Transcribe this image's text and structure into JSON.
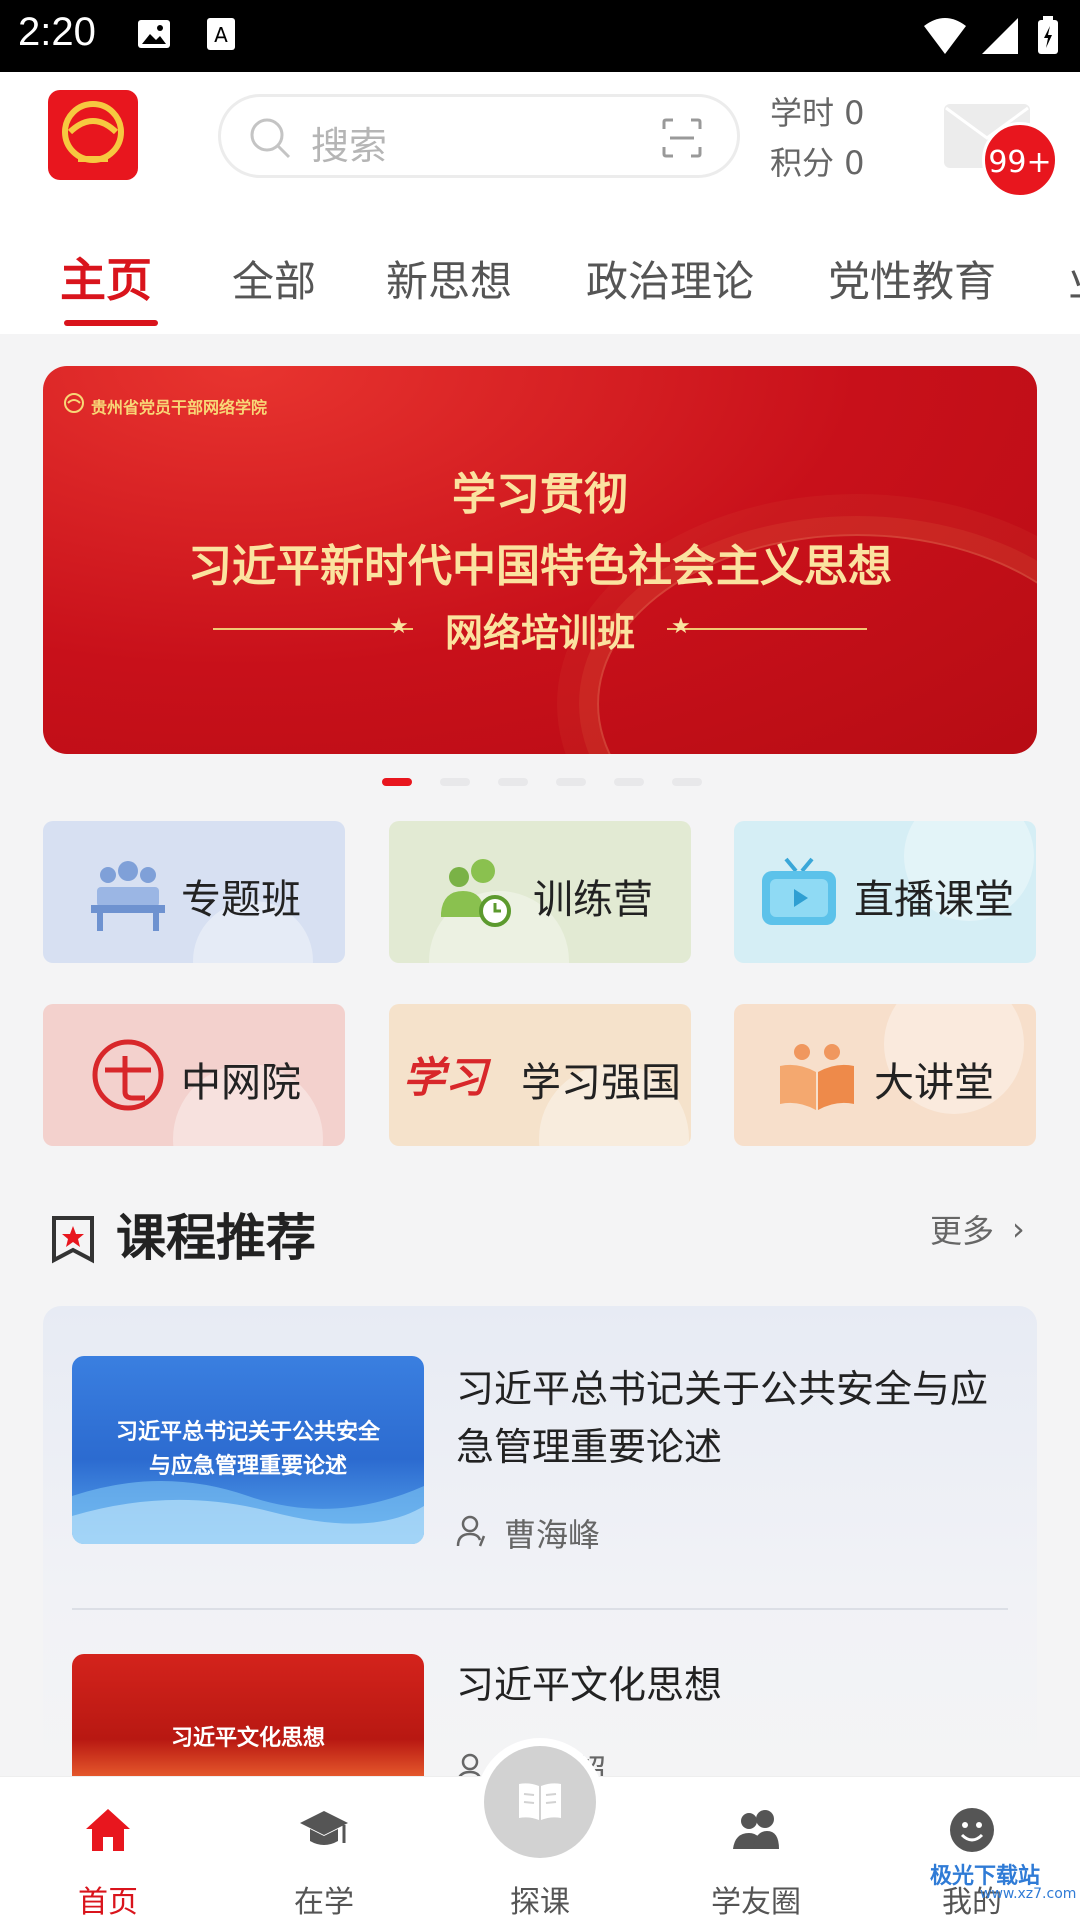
{
  "status_bar": {
    "time": "2:20"
  },
  "header": {
    "search_placeholder": "搜索",
    "study_hours": "学时 0",
    "points": "积分 0",
    "mail_badge": "99+"
  },
  "tabs": [
    "主页",
    "全部",
    "新思想",
    "政治理论",
    "党性教育",
    "业"
  ],
  "banner": {
    "org": "贵州省党员干部网络学院",
    "line1": "学习贯彻",
    "line2": "习近平新时代中国特色社会主义思想",
    "line3": "网络培训班"
  },
  "quick_links": [
    "专题班",
    "训练营",
    "直播课堂",
    "中网院",
    "学习强国",
    "大讲堂"
  ],
  "section": {
    "title": "课程推荐",
    "more": "更多"
  },
  "courses": [
    {
      "thumb_caption_1": "习近平总书记关于公共安全",
      "thumb_caption_2": "与应急管理重要论述",
      "title": "习近平总书记关于公共安全与应急管理重要论述",
      "author": "曹海峰"
    },
    {
      "thumb_caption_1": "习近平文化思想",
      "title": "习近平文化思想",
      "author": "超"
    }
  ],
  "bottom_nav": [
    "首页",
    "在学",
    "探课",
    "学友圈",
    "我的"
  ],
  "watermark": "极光下载站",
  "watermark_url": "www.xz7.com",
  "colors": {
    "primary": "#d9141c",
    "banner_red": "#c8101a",
    "gold": "#fbe3a0"
  }
}
